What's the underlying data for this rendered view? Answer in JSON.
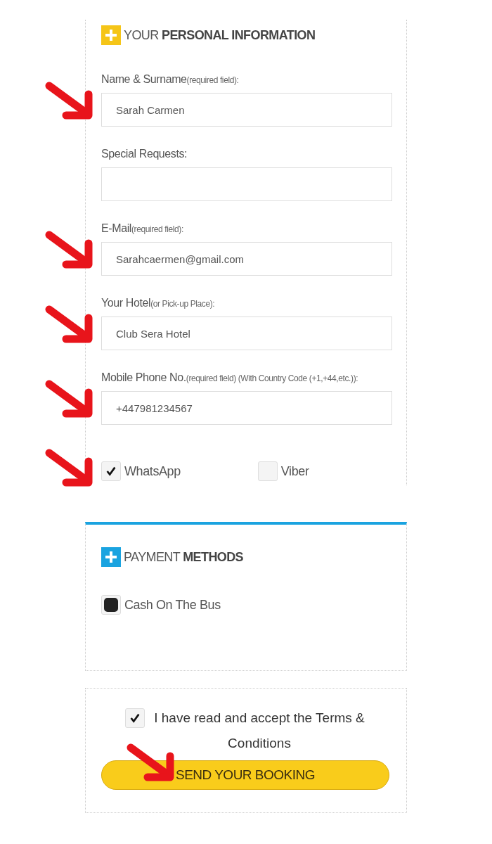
{
  "personal_information": {
    "title": "YOUR **PERSONAL INFORMATION**",
    "fields": [
      {
        "label": "Name & Surname",
        "hint": "(required field):",
        "value": "Sarah Carmen",
        "arrow": true
      },
      {
        "label": "Special Requests:",
        "arrow": false
      },
      {
        "label": "E-Mail",
        "hint": "(required field):",
        "value": "Sarahcaermen@gmail.com",
        "arrow": true
      },
      {
        "label": "Your Hotel",
        "hint": "(or Pick-up Place):",
        "value": "Club Sera Hotel",
        "arrow": true
      },
      {
        "label": "Mobile Phone No.",
        "hint": "(required field) (With Country Code (+1,+44,etc.)):",
        "value": "+447981234567",
        "arrow": true
      }
    ],
    "messengers_arrow": true,
    "messengers": [
      {
        "label": "WhatsApp",
        "checked": true
      },
      {
        "label": "Viber",
        "checked": false
      }
    ]
  },
  "payment_methods": {
    "title": "PAYMENT **METHODS**",
    "options": [
      {
        "label": "Cash On The Bus",
        "checked": true
      }
    ]
  },
  "terms": {
    "text": "I have read and accept the Terms & Conditions",
    "checked": true
  },
  "submit": {
    "label": "SEND YOUR BOOKING",
    "arrow": true
  }
}
